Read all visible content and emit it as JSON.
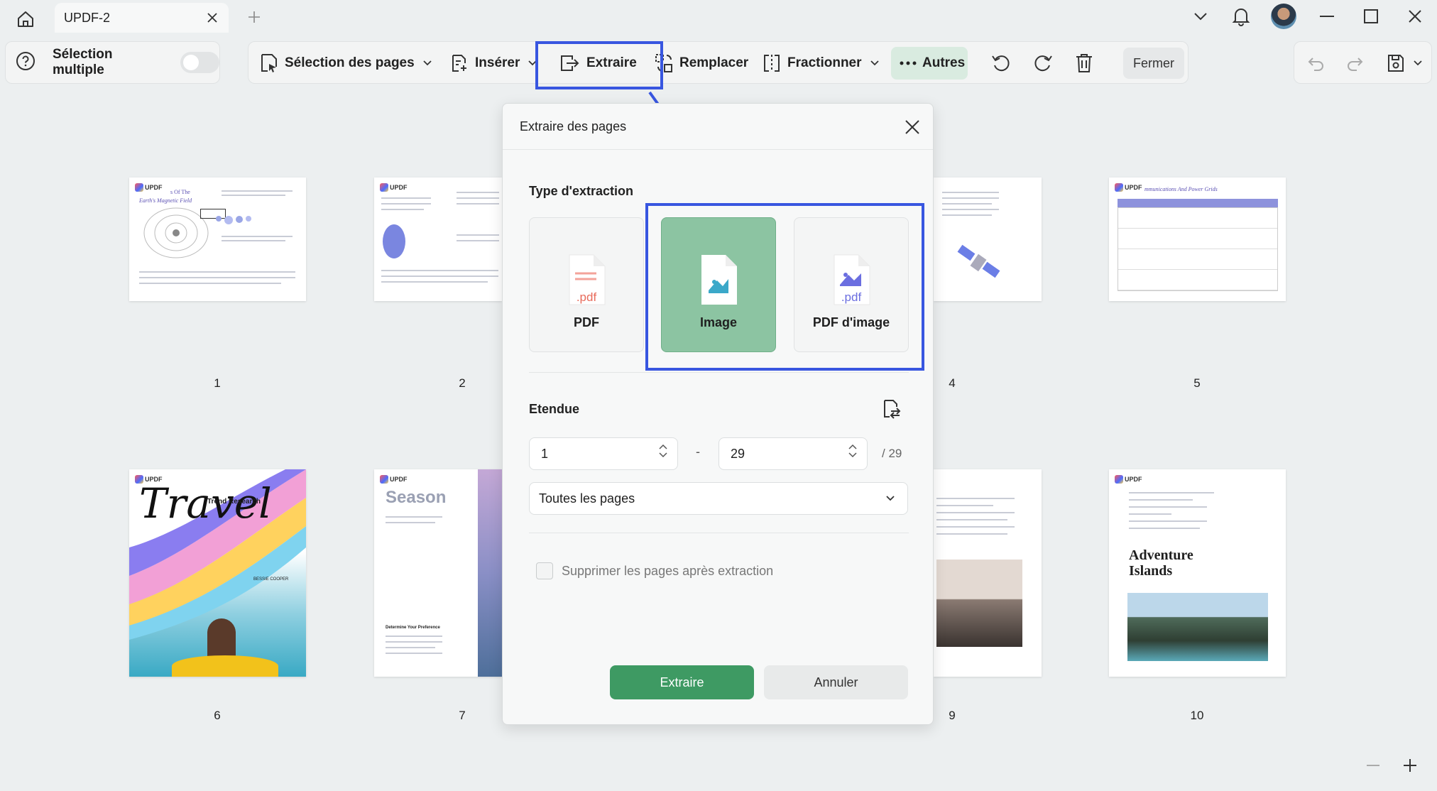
{
  "titlebar": {
    "tab_title": "UPDF-2"
  },
  "toolbar": {
    "multi_select_label": "Sélection multiple",
    "page_select_label": "Sélection des pages",
    "insert_label": "Insérer",
    "extract_label": "Extraire",
    "replace_label": "Remplacer",
    "split_label": "Fractionner",
    "more_label": "Autres",
    "close_label": "Fermer"
  },
  "pages": [
    {
      "num": "1",
      "text_title": "s Of The",
      "text_subtitle": "Earth's Magnetic Field"
    },
    {
      "num": "2"
    },
    {
      "num": "4"
    },
    {
      "num": "5",
      "text_title": "mmunications And Power Grids"
    },
    {
      "num": "6",
      "text_title": "Travel",
      "text_subtitle": "Trend Research",
      "text_author": "BESSIE COOPER"
    },
    {
      "num": "7",
      "text_title": "Season",
      "text_sub": "Determine Your Preference"
    },
    {
      "num": "9"
    },
    {
      "num": "10",
      "text_title": "Adventure Islands"
    }
  ],
  "dialog": {
    "title": "Extraire des pages",
    "extraction_type_label": "Type d'extraction",
    "options": [
      {
        "label": "PDF",
        "ext": ".pdf",
        "selected": false
      },
      {
        "label": "Image",
        "selected": true
      },
      {
        "label": "PDF d'image",
        "ext": ".pdf",
        "selected": false
      }
    ],
    "range_label": "Etendue",
    "range_from": "1",
    "range_to": "29",
    "range_total": "/ 29",
    "range_dash": "-",
    "page_subset": "Toutes les pages",
    "delete_after_label": "Supprimer les pages après extraction",
    "extract_button": "Extraire",
    "cancel_button": "Annuler"
  },
  "colors": {
    "accent_green": "#3e9a63",
    "selected_card": "#8cc4a2",
    "highlight_blue": "#3856e0"
  }
}
